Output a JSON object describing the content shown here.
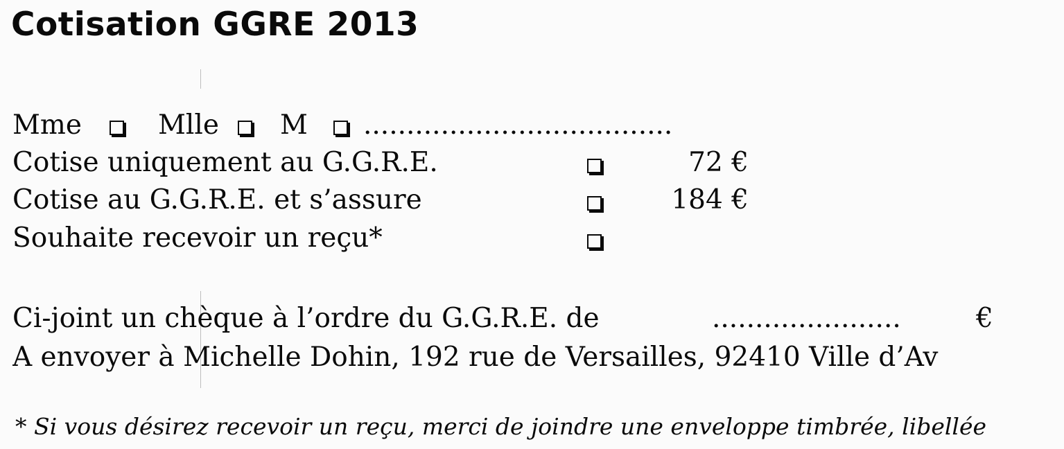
{
  "title": "Cotisation GGRE 2013",
  "civility": {
    "options": [
      "Mme",
      "Mlle",
      "M"
    ],
    "name_line": "...................................."
  },
  "options": [
    {
      "label": "Cotise uniquement au G.G.R.E.",
      "price": "72 €"
    },
    {
      "label": "Cotise au G.G.R.E. et s’assure",
      "price": "184 €"
    },
    {
      "label": "Souhaite recevoir un reçu*",
      "price": ""
    }
  ],
  "cheque": {
    "text": "Ci-joint un chèque à l’ordre du G.G.R.E. de",
    "amount_line": "......................",
    "currency": "€"
  },
  "address": "A envoyer à Michelle Dohin, 192 rue de Versailles, 92410 Ville d’Av",
  "footnote": "* Si vous désirez recevoir un reçu, merci de joindre une enveloppe timbrée, libellée"
}
